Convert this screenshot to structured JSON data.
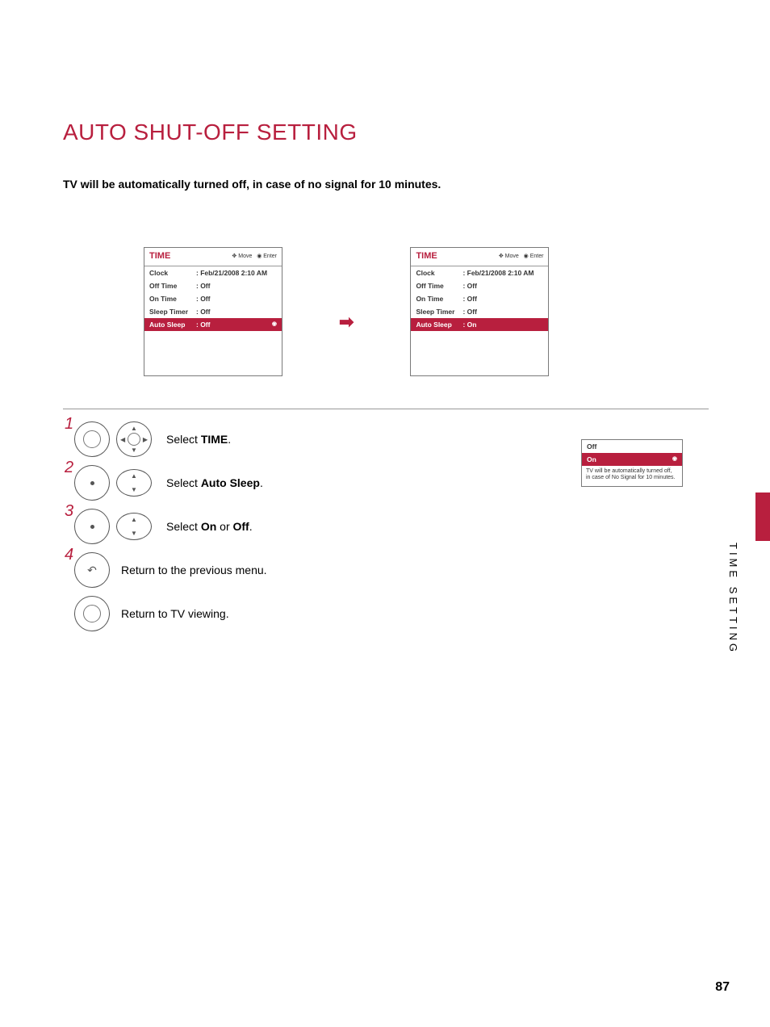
{
  "page": {
    "title": "AUTO SHUT-OFF SETTING",
    "subtitle": "TV will be automatically turned off, in case of no signal for 10 minutes.",
    "side_label": "TIME SETTING",
    "page_number": "87"
  },
  "menu_left": {
    "title": "TIME",
    "hint_move": "Move",
    "hint_enter": "Enter",
    "rows": [
      {
        "k": "Clock",
        "v": ": Feb/21/2008  2:10 AM"
      },
      {
        "k": "Off Time",
        "v": ": Off"
      },
      {
        "k": "On Time",
        "v": ": Off"
      },
      {
        "k": "Sleep Timer",
        "v": ": Off"
      },
      {
        "k": "Auto Sleep",
        "v": ": Off"
      }
    ]
  },
  "menu_right": {
    "title": "TIME",
    "hint_move": "Move",
    "hint_enter": "Enter",
    "rows": [
      {
        "k": "Clock",
        "v": ": Feb/21/2008  2:10 AM"
      },
      {
        "k": "Off Time",
        "v": ": Off"
      },
      {
        "k": "On Time",
        "v": ": Off"
      },
      {
        "k": "Sleep Timer",
        "v": ": Off"
      },
      {
        "k": "Auto Sleep",
        "v": ": On"
      }
    ],
    "submenu": {
      "off": "Off",
      "on": "On",
      "note_line1": "TV will be automatically turned off,",
      "note_line2": "in case of No Signal for 10 minutes."
    }
  },
  "steps": {
    "s1_num": "1",
    "s1_prefix": "Select ",
    "s1_bold": "TIME",
    "s1_suffix": ".",
    "s2_num": "2",
    "s2_prefix": "Select ",
    "s2_bold": "Auto Sleep",
    "s2_suffix": ".",
    "s3_num": "3",
    "s3_prefix": "Select ",
    "s3_bold1": "On",
    "s3_mid": " or ",
    "s3_bold2": "Off",
    "s3_suffix": ".",
    "s4_num": "4",
    "s4_text": "Return to the previous menu.",
    "s5_text": "Return to TV viewing."
  }
}
